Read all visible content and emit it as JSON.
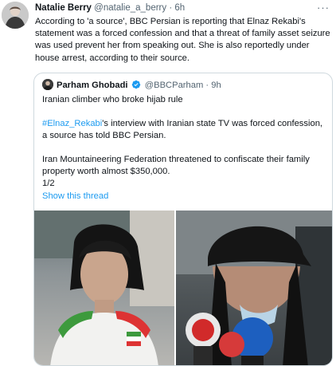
{
  "tweet": {
    "author_name": "Natalie Berry",
    "author_handle": "@natalie_a_berry",
    "separator": "·",
    "time": "6h",
    "more_label": "···",
    "text": "According to 'a source', BBC Persian is reporting that Elnaz Rekabi's statement was a forced confession and that a threat of family asset seizure was used prevent her from speaking out. She is also reportedly under house arrest, according to their source."
  },
  "quote": {
    "author_name": "Parham Ghobadi",
    "author_handle": "@BBCParham",
    "separator": "·",
    "time": "9h",
    "line1": "Iranian climber who broke hijab rule",
    "hashtag": "#Elnaz_Rekabi",
    "line2_rest": "'s interview with Iranian state TV was forced confession, a source has told BBC Persian.",
    "line3": "Iran Mountaineering Federation threatened to confiscate their family property worth almost $350,000.",
    "line4": "1/2",
    "show_thread": "Show this thread"
  },
  "icons": {
    "verified": "verified-badge-icon",
    "more": "more-dots-icon"
  },
  "colors": {
    "link": "#1d9bf0",
    "muted": "#536471",
    "border": "#cfd9de"
  }
}
